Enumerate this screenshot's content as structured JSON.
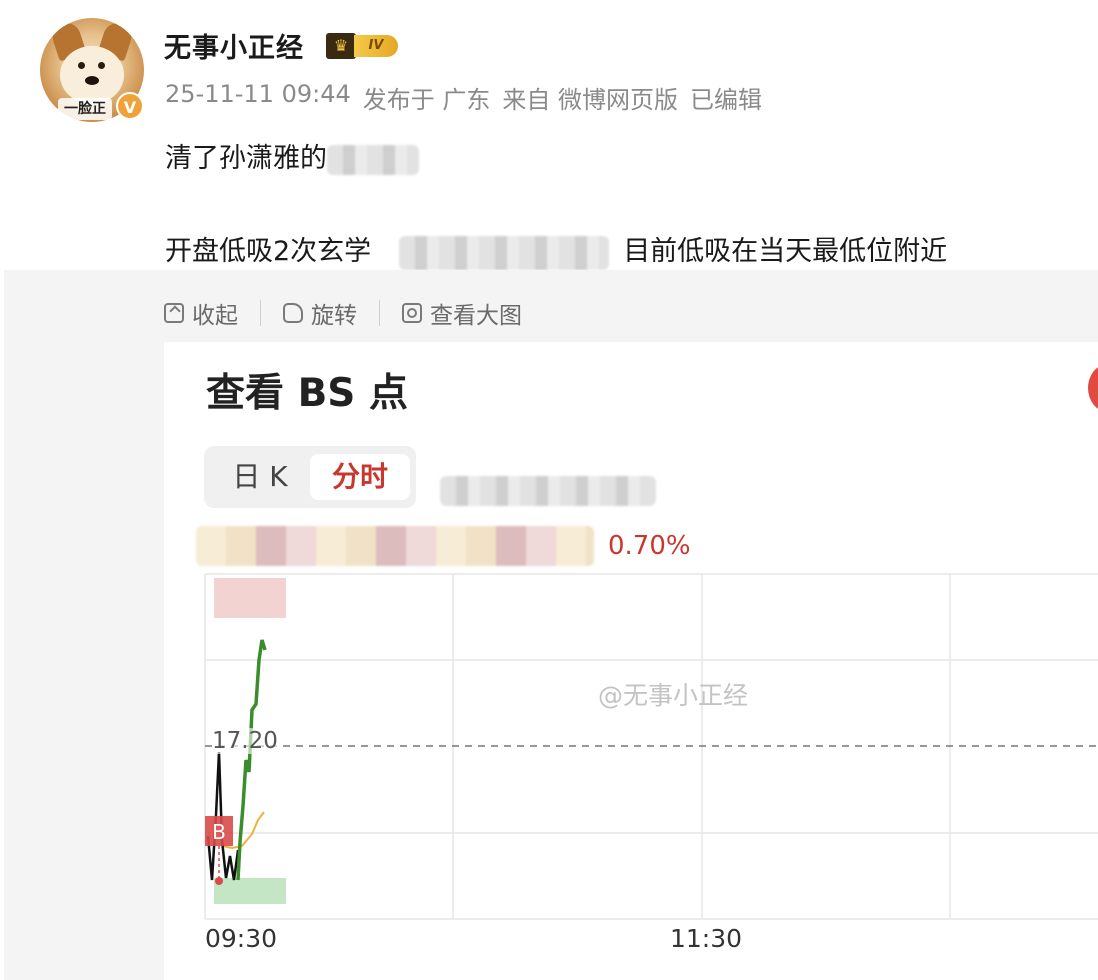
{
  "post": {
    "username": "无事小正经",
    "level": "IV",
    "avatar_caption": "一脸正",
    "verify": "V",
    "meta": {
      "datetime": "25-11-11 09:44",
      "location": "发布于 广东",
      "source": "来自 微博网页版",
      "edited": "已编辑"
    },
    "line1": "清了孙潇雅的",
    "line2_prefix": "开盘低吸2次玄学",
    "line2_suffix": "目前低吸在当天最低位附近"
  },
  "toolbar": {
    "collapse": "收起",
    "rotate": "旋转",
    "view_large": "查看大图"
  },
  "image": {
    "title": "查看 BS 点",
    "tabs": [
      {
        "label": "日 K",
        "selected": false
      },
      {
        "label": "分时",
        "selected": true
      }
    ],
    "change_pct": "0.70%",
    "watermark": "@无事小正经",
    "ref_price_label": "17.20",
    "buy_marker": "B"
  },
  "chart_data": {
    "type": "line",
    "x_ticks": [
      "09:30",
      "11:30"
    ],
    "reference_price": 17.2,
    "series": [
      {
        "color": "#3a8d2a",
        "values": [
          16.85,
          16.95,
          17.25,
          17.4,
          17.6
        ]
      }
    ],
    "markers": [
      {
        "label": "B",
        "color": "#d94a4a"
      }
    ],
    "colors": {
      "price_line": "#3a8d2a",
      "avg_line": "#f0b040",
      "early_line": "#111111",
      "buy_marker": "#d94a4a",
      "accent_red": "#c9382f"
    }
  }
}
